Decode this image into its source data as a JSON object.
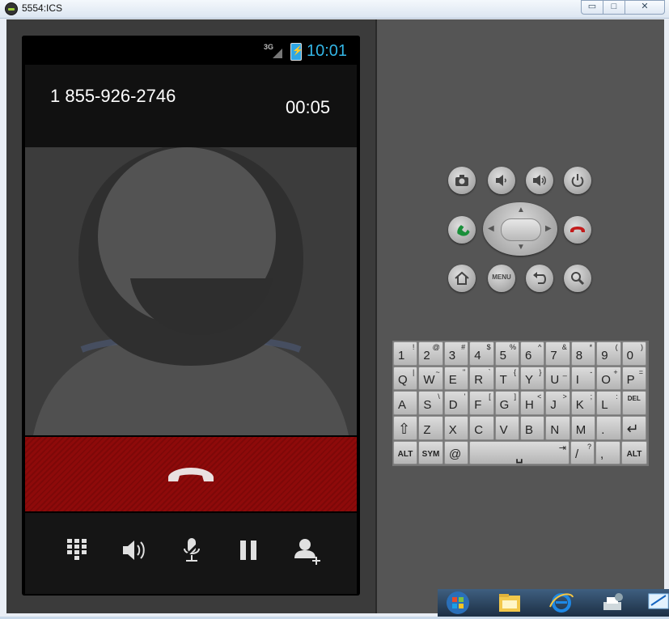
{
  "window": {
    "title": "5554:ICS"
  },
  "status_bar": {
    "network": "3G",
    "time": "10:01"
  },
  "call": {
    "number": "1 855-926-2746",
    "duration": "00:05"
  },
  "colors": {
    "end_call": "#8e0a0a",
    "status_time": "#33b5e5",
    "answer_green": "#1a8f3a",
    "hangup_red": "#c21b1b"
  },
  "controls": [
    {
      "name": "dialpad-icon"
    },
    {
      "name": "speaker-icon"
    },
    {
      "name": "mute-microphone-icon"
    },
    {
      "name": "hold-icon"
    },
    {
      "name": "add-call-icon"
    }
  ],
  "hardware_buttons": {
    "menu_label": "MENU"
  },
  "keyboard": {
    "row1": [
      {
        "main": "1",
        "alt": "!"
      },
      {
        "main": "2",
        "alt": "@"
      },
      {
        "main": "3",
        "alt": "#"
      },
      {
        "main": "4",
        "alt": "$"
      },
      {
        "main": "5",
        "alt": "%"
      },
      {
        "main": "6",
        "alt": "^"
      },
      {
        "main": "7",
        "alt": "&"
      },
      {
        "main": "8",
        "alt": "*"
      },
      {
        "main": "9",
        "alt": "("
      },
      {
        "main": "0",
        "alt": ")"
      }
    ],
    "row2": [
      {
        "main": "Q",
        "alt": "|"
      },
      {
        "main": "W",
        "alt": "~"
      },
      {
        "main": "E",
        "alt": "\""
      },
      {
        "main": "R",
        "alt": "`"
      },
      {
        "main": "T",
        "alt": "{"
      },
      {
        "main": "Y",
        "alt": "}"
      },
      {
        "main": "U",
        "alt": "_"
      },
      {
        "main": "I",
        "alt": "-"
      },
      {
        "main": "O",
        "alt": "+"
      },
      {
        "main": "P",
        "alt": "="
      }
    ],
    "row3": [
      {
        "main": "A",
        "alt": ""
      },
      {
        "main": "S",
        "alt": "\\"
      },
      {
        "main": "D",
        "alt": "'"
      },
      {
        "main": "F",
        "alt": "["
      },
      {
        "main": "G",
        "alt": "]"
      },
      {
        "main": "H",
        "alt": "<"
      },
      {
        "main": "J",
        "alt": ">"
      },
      {
        "main": "K",
        "alt": ";"
      },
      {
        "main": "L",
        "alt": ":"
      },
      {
        "main": "DEL",
        "alt": ""
      }
    ],
    "row4": [
      {
        "main": "⇧",
        "alt": ""
      },
      {
        "main": "Z",
        "alt": ""
      },
      {
        "main": "X",
        "alt": ""
      },
      {
        "main": "C",
        "alt": ""
      },
      {
        "main": "V",
        "alt": ""
      },
      {
        "main": "B",
        "alt": ""
      },
      {
        "main": "N",
        "alt": ""
      },
      {
        "main": "M",
        "alt": ""
      },
      {
        "main": ".",
        "alt": ""
      },
      {
        "main": "↵",
        "alt": ""
      }
    ],
    "row5": {
      "alt_left": "ALT",
      "sym": "SYM",
      "at": "@",
      "space": "␣",
      "tab": "⇥",
      "slash": "/",
      "slash_alt": "?",
      "comma": ",",
      "alt_right": "ALT"
    }
  }
}
